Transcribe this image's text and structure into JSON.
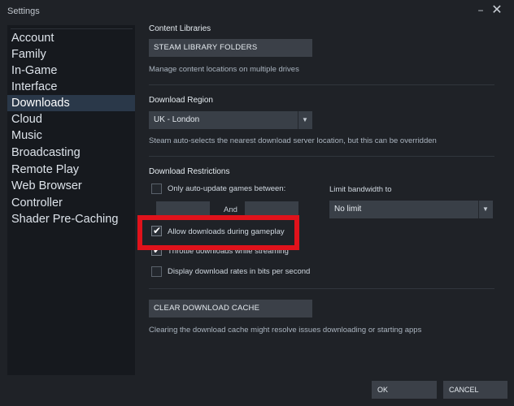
{
  "window": {
    "title": "Settings",
    "minimize_glyph": "−",
    "close_glyph": "✕"
  },
  "sidebar": {
    "items": [
      {
        "label": "Account"
      },
      {
        "label": "Family"
      },
      {
        "label": "In-Game"
      },
      {
        "label": "Interface"
      },
      {
        "label": "Downloads",
        "active": true
      },
      {
        "label": "Cloud"
      },
      {
        "label": "Music"
      },
      {
        "label": "Broadcasting"
      },
      {
        "label": "Remote Play"
      },
      {
        "label": "Web Browser"
      },
      {
        "label": "Controller"
      },
      {
        "label": "Shader Pre-Caching"
      }
    ]
  },
  "content_libraries": {
    "heading": "Content Libraries",
    "button_label": "STEAM LIBRARY FOLDERS",
    "description": "Manage content locations on multiple drives"
  },
  "download_region": {
    "heading": "Download Region",
    "selected": "UK - London",
    "description": "Steam auto-selects the nearest download server location, but this can be overridden"
  },
  "download_restrictions": {
    "heading": "Download Restrictions",
    "auto_update_label": "Only auto-update games between:",
    "auto_update_checked": false,
    "and_label": "And",
    "bandwidth_label": "Limit bandwidth to",
    "bandwidth_selected": "No limit",
    "allow_during_gameplay_label": "Allow downloads during gameplay",
    "allow_during_gameplay_checked": true,
    "throttle_label": "Throttle downloads while streaming",
    "throttle_checked": true,
    "bits_label": "Display download rates in bits per second",
    "bits_checked": false
  },
  "cache": {
    "button_label": "CLEAR DOWNLOAD CACHE",
    "description": "Clearing the download cache might resolve issues downloading or starting apps"
  },
  "footer": {
    "ok_label": "OK",
    "cancel_label": "CANCEL"
  },
  "icons": {
    "dropdown": "▼",
    "check": "✔"
  },
  "colors": {
    "accent_active": "#2a3849",
    "highlight": "#e0121b",
    "background": "#1f2227"
  }
}
